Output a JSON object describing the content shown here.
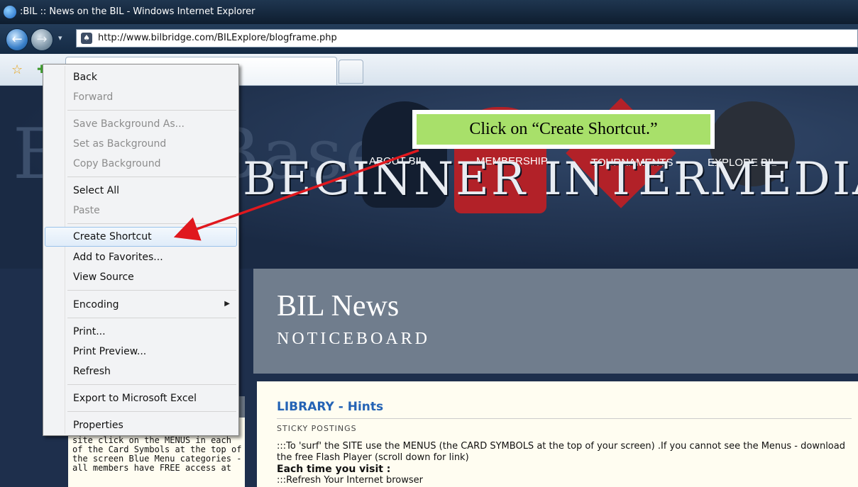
{
  "window": {
    "title": ":BIL :: News on the BIL - Windows Internet Explorer",
    "url": "http://www.bilbridge.com/BILExplore/blogframe.php"
  },
  "toolbar": {
    "back_glyph": "←",
    "forward_glyph": "→",
    "recent_caret": "▾",
    "fav_star": "☆",
    "add_fav": "✚"
  },
  "site": {
    "background_word": "Blue Base",
    "menu": [
      "ABOUT BIL",
      "MEMBERSHIP",
      "TOURNAMENTS",
      "EXPLORE BIL"
    ],
    "title_banner": "BEGINNER INTERMEDIATE LOU",
    "news_title": "BIL News",
    "news_subtitle": "NOTICEBOARD",
    "library_heading": "LIBRARY",
    "library_sep": " - ",
    "library_heading2": "Hints",
    "sticky": "STICKY POSTINGS",
    "body_line1": ":::To 'surf' the SITE use the MENUS (the CARD SYMBOLS at the top of your screen) .If you cannot see the Menus - download the free Flash Player (scroll down for link)",
    "body_line2": "Each time you visit :",
    "body_line3": ":::Refresh Your Internet browser",
    "left_text": "site click on the MENUS in each of the Card Symbols at the top of the screen Blue Menu categories - all members have FREE access at"
  },
  "context_menu": {
    "items": [
      {
        "label": "Back",
        "enabled": true
      },
      {
        "label": "Forward",
        "enabled": false
      },
      {
        "label": "Save Background As...",
        "enabled": false
      },
      {
        "label": "Set as Background",
        "enabled": false
      },
      {
        "label": "Copy Background",
        "enabled": false
      },
      {
        "label": "Select All",
        "enabled": true
      },
      {
        "label": "Paste",
        "enabled": false
      },
      {
        "label": "Create Shortcut",
        "enabled": true,
        "highlighted": true
      },
      {
        "label": "Add to Favorites...",
        "enabled": true
      },
      {
        "label": "View Source",
        "enabled": true
      },
      {
        "label": "Encoding",
        "enabled": true,
        "submenu": true
      },
      {
        "label": "Print...",
        "enabled": true
      },
      {
        "label": "Print Preview...",
        "enabled": true
      },
      {
        "label": "Refresh",
        "enabled": true
      },
      {
        "label": "Export to Microsoft Excel",
        "enabled": true
      },
      {
        "label": "Properties",
        "enabled": true
      }
    ],
    "submenu_arrow": "▶"
  },
  "callout": {
    "text": "Click on “Create Shortcut.”"
  },
  "colors": {
    "callout_bg": "#a8e06a",
    "arrow": "#e0181e",
    "link_blue": "#2463b5"
  }
}
